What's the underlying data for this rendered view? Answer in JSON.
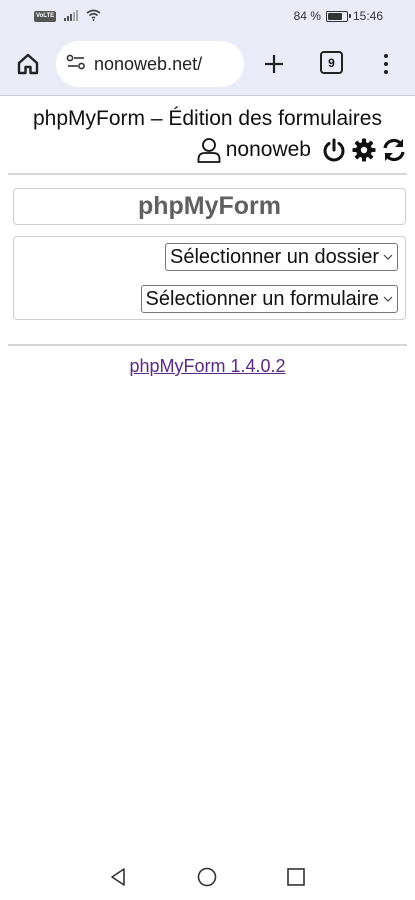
{
  "status_bar": {
    "network_badge": "VoLTE",
    "battery": "84 %",
    "battery_level": 0.84,
    "time": "15:46"
  },
  "browser": {
    "url": "nonoweb.net/",
    "tab_count": "9",
    "icons": [
      "home-icon",
      "site-settings-icon",
      "new-tab-icon",
      "tabs-icon",
      "more-menu-icon"
    ]
  },
  "page": {
    "title": "phpMyForm – Édition des formulaires",
    "user": {
      "name": "nonoweb"
    },
    "app_name": "phpMyForm",
    "selects": {
      "folder": "Sélectionner un dossier",
      "form": "Sélectionner un formulaire"
    },
    "footer_link": "phpMyForm 1.4.0.2"
  },
  "colors": {
    "chrome_bg": "#e9ecf6",
    "link": "#5b2a86",
    "app_name": "#606060"
  }
}
